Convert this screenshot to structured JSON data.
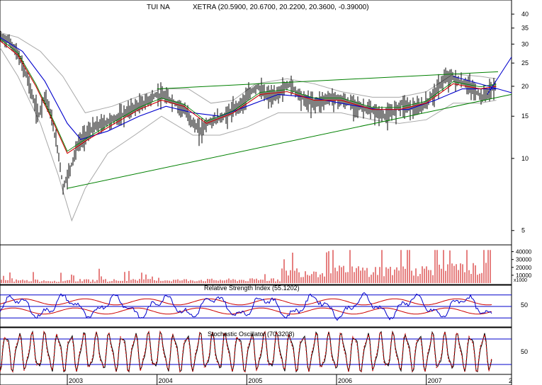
{
  "chart_data": {
    "type": "line",
    "title": {
      "symbol": "TUI NA",
      "quote": "XETRA (20.5900, 20.6700, 20.2200, 20.3600, -0.39000)"
    },
    "price_axis": {
      "scale": "log",
      "ylim": [
        4.6,
        44
      ],
      "ticks": [
        40,
        35,
        30,
        25,
        20,
        15,
        10,
        5
      ]
    },
    "x_axis": {
      "xlim": [
        2002.25,
        2007.95
      ],
      "ticks": [
        2003,
        2004,
        2005,
        2006,
        2007
      ],
      "tick_labels": [
        "2003",
        "2004",
        "2005",
        "2006",
        "2007"
      ],
      "edge_label": "2"
    },
    "price_series": [
      {
        "x": 2002.25,
        "y": 32.0
      },
      {
        "x": 2002.35,
        "y": 31.0
      },
      {
        "x": 2002.45,
        "y": 27.0
      },
      {
        "x": 2002.55,
        "y": 22.0
      },
      {
        "x": 2002.62,
        "y": 17.5
      },
      {
        "x": 2002.68,
        "y": 15.0
      },
      {
        "x": 2002.75,
        "y": 18.5
      },
      {
        "x": 2002.8,
        "y": 16.0
      },
      {
        "x": 2002.86,
        "y": 12.5
      },
      {
        "x": 2002.91,
        "y": 10.0
      },
      {
        "x": 2002.95,
        "y": 7.5
      },
      {
        "x": 2002.99,
        "y": 8.2
      },
      {
        "x": 2003.05,
        "y": 9.5
      },
      {
        "x": 2003.12,
        "y": 11.5
      },
      {
        "x": 2003.2,
        "y": 12.5
      },
      {
        "x": 2003.3,
        "y": 13.5
      },
      {
        "x": 2003.4,
        "y": 14.0
      },
      {
        "x": 2003.5,
        "y": 14.5
      },
      {
        "x": 2003.6,
        "y": 15.0
      },
      {
        "x": 2003.7,
        "y": 16.0
      },
      {
        "x": 2003.85,
        "y": 17.0
      },
      {
        "x": 2003.95,
        "y": 18.0
      },
      {
        "x": 2004.0,
        "y": 18.5
      },
      {
        "x": 2004.1,
        "y": 18.0
      },
      {
        "x": 2004.2,
        "y": 17.0
      },
      {
        "x": 2004.3,
        "y": 16.0
      },
      {
        "x": 2004.4,
        "y": 14.0
      },
      {
        "x": 2004.48,
        "y": 13.0
      },
      {
        "x": 2004.55,
        "y": 14.0
      },
      {
        "x": 2004.65,
        "y": 14.5
      },
      {
        "x": 2004.75,
        "y": 15.0
      },
      {
        "x": 2004.85,
        "y": 16.0
      },
      {
        "x": 2004.95,
        "y": 17.0
      },
      {
        "x": 2005.05,
        "y": 19.0
      },
      {
        "x": 2005.12,
        "y": 20.0
      },
      {
        "x": 2005.2,
        "y": 18.5
      },
      {
        "x": 2005.3,
        "y": 18.0
      },
      {
        "x": 2005.4,
        "y": 19.5
      },
      {
        "x": 2005.48,
        "y": 20.5
      },
      {
        "x": 2005.55,
        "y": 19.0
      },
      {
        "x": 2005.65,
        "y": 17.5
      },
      {
        "x": 2005.75,
        "y": 17.0
      },
      {
        "x": 2005.85,
        "y": 17.5
      },
      {
        "x": 2005.95,
        "y": 18.0
      },
      {
        "x": 2006.05,
        "y": 17.5
      },
      {
        "x": 2006.15,
        "y": 17.0
      },
      {
        "x": 2006.25,
        "y": 16.5
      },
      {
        "x": 2006.35,
        "y": 16.0
      },
      {
        "x": 2006.45,
        "y": 15.5
      },
      {
        "x": 2006.55,
        "y": 15.0
      },
      {
        "x": 2006.62,
        "y": 15.5
      },
      {
        "x": 2006.72,
        "y": 17.0
      },
      {
        "x": 2006.8,
        "y": 16.5
      },
      {
        "x": 2006.9,
        "y": 16.0
      },
      {
        "x": 2007.0,
        "y": 17.0
      },
      {
        "x": 2007.1,
        "y": 19.0
      },
      {
        "x": 2007.2,
        "y": 21.5
      },
      {
        "x": 2007.28,
        "y": 22.0
      },
      {
        "x": 2007.35,
        "y": 21.0
      },
      {
        "x": 2007.45,
        "y": 20.5
      },
      {
        "x": 2007.55,
        "y": 19.0
      },
      {
        "x": 2007.62,
        "y": 18.0
      },
      {
        "x": 2007.7,
        "y": 19.0
      },
      {
        "x": 2007.78,
        "y": 20.4
      }
    ],
    "ma_short": [
      {
        "x": 2002.25,
        "y": 31.0
      },
      {
        "x": 2002.45,
        "y": 27.0
      },
      {
        "x": 2002.65,
        "y": 20.0
      },
      {
        "x": 2002.85,
        "y": 14.0
      },
      {
        "x": 2003.0,
        "y": 10.5
      },
      {
        "x": 2003.2,
        "y": 11.8
      },
      {
        "x": 2003.5,
        "y": 13.8
      },
      {
        "x": 2003.8,
        "y": 16.0
      },
      {
        "x": 2004.05,
        "y": 17.5
      },
      {
        "x": 2004.3,
        "y": 16.5
      },
      {
        "x": 2004.55,
        "y": 14.0
      },
      {
        "x": 2004.85,
        "y": 15.5
      },
      {
        "x": 2005.15,
        "y": 18.5
      },
      {
        "x": 2005.45,
        "y": 19.0
      },
      {
        "x": 2005.75,
        "y": 17.5
      },
      {
        "x": 2006.05,
        "y": 17.5
      },
      {
        "x": 2006.4,
        "y": 16.0
      },
      {
        "x": 2006.7,
        "y": 16.0
      },
      {
        "x": 2007.0,
        "y": 17.0
      },
      {
        "x": 2007.3,
        "y": 20.5
      },
      {
        "x": 2007.6,
        "y": 19.5
      },
      {
        "x": 2007.78,
        "y": 20.0
      }
    ],
    "ma_long": [
      {
        "x": 2002.25,
        "y": 32.0
      },
      {
        "x": 2002.5,
        "y": 28.0
      },
      {
        "x": 2002.75,
        "y": 21.0
      },
      {
        "x": 2003.0,
        "y": 14.0
      },
      {
        "x": 2003.15,
        "y": 12.0
      },
      {
        "x": 2003.45,
        "y": 13.0
      },
      {
        "x": 2003.8,
        "y": 15.0
      },
      {
        "x": 2004.1,
        "y": 16.5
      },
      {
        "x": 2004.4,
        "y": 15.5
      },
      {
        "x": 2004.7,
        "y": 15.0
      },
      {
        "x": 2005.0,
        "y": 16.5
      },
      {
        "x": 2005.35,
        "y": 18.5
      },
      {
        "x": 2005.7,
        "y": 18.0
      },
      {
        "x": 2006.05,
        "y": 17.0
      },
      {
        "x": 2006.45,
        "y": 16.0
      },
      {
        "x": 2006.8,
        "y": 16.0
      },
      {
        "x": 2007.1,
        "y": 17.5
      },
      {
        "x": 2007.4,
        "y": 19.5
      },
      {
        "x": 2007.78,
        "y": 19.5
      }
    ],
    "bollinger_upper": [
      {
        "x": 2002.25,
        "y": 33.5
      },
      {
        "x": 2002.45,
        "y": 32.0
      },
      {
        "x": 2002.7,
        "y": 28.0
      },
      {
        "x": 2002.95,
        "y": 22.0
      },
      {
        "x": 2003.2,
        "y": 15.5
      },
      {
        "x": 2003.5,
        "y": 16.5
      },
      {
        "x": 2003.85,
        "y": 18.5
      },
      {
        "x": 2004.05,
        "y": 19.5
      },
      {
        "x": 2004.35,
        "y": 19.5
      },
      {
        "x": 2004.6,
        "y": 17.0
      },
      {
        "x": 2004.85,
        "y": 17.5
      },
      {
        "x": 2005.1,
        "y": 20.5
      },
      {
        "x": 2005.45,
        "y": 21.5
      },
      {
        "x": 2005.75,
        "y": 20.5
      },
      {
        "x": 2006.05,
        "y": 19.0
      },
      {
        "x": 2006.4,
        "y": 18.0
      },
      {
        "x": 2006.7,
        "y": 18.0
      },
      {
        "x": 2007.0,
        "y": 19.0
      },
      {
        "x": 2007.3,
        "y": 22.5
      },
      {
        "x": 2007.6,
        "y": 22.0
      },
      {
        "x": 2007.78,
        "y": 21.5
      }
    ],
    "bollinger_lower": [
      {
        "x": 2002.25,
        "y": 29.0
      },
      {
        "x": 2002.45,
        "y": 22.0
      },
      {
        "x": 2002.7,
        "y": 14.0
      },
      {
        "x": 2002.9,
        "y": 8.5
      },
      {
        "x": 2003.05,
        "y": 5.5
      },
      {
        "x": 2003.2,
        "y": 7.5
      },
      {
        "x": 2003.45,
        "y": 10.5
      },
      {
        "x": 2003.75,
        "y": 12.5
      },
      {
        "x": 2004.05,
        "y": 15.0
      },
      {
        "x": 2004.4,
        "y": 12.5
      },
      {
        "x": 2004.7,
        "y": 12.5
      },
      {
        "x": 2005.0,
        "y": 13.5
      },
      {
        "x": 2005.35,
        "y": 15.5
      },
      {
        "x": 2005.7,
        "y": 15.5
      },
      {
        "x": 2006.05,
        "y": 15.5
      },
      {
        "x": 2006.4,
        "y": 14.5
      },
      {
        "x": 2006.7,
        "y": 14.0
      },
      {
        "x": 2007.0,
        "y": 14.5
      },
      {
        "x": 2007.3,
        "y": 17.0
      },
      {
        "x": 2007.6,
        "y": 17.0
      },
      {
        "x": 2007.78,
        "y": 17.5
      }
    ],
    "trendlines": [
      {
        "color": "#008000",
        "points": [
          {
            "x": 2004.0,
            "y": 19.5
          },
          {
            "x": 2007.8,
            "y": 23.0
          }
        ]
      },
      {
        "color": "#008000",
        "points": [
          {
            "x": 2003.0,
            "y": 7.5
          },
          {
            "x": 2007.95,
            "y": 18.5
          }
        ]
      },
      {
        "color": "#0000cc",
        "points": [
          {
            "x": 2007.3,
            "y": 22.0
          },
          {
            "x": 2007.95,
            "y": 18.8
          }
        ]
      },
      {
        "color": "#0000cc",
        "points": [
          {
            "x": 2007.68,
            "y": 18.5
          },
          {
            "x": 2007.95,
            "y": 26.5
          }
        ]
      }
    ],
    "volume": {
      "ticks": [
        40000,
        30000,
        20000,
        10000
      ],
      "tick_labels": [
        "40000",
        "30000",
        "20000",
        "10000"
      ],
      "multiplier_label": "x1000",
      "ylim": [
        0,
        45000
      ],
      "color": "#cc0000"
    },
    "rsi": {
      "label": "Relative Strength Index (55.1202)",
      "tick_label": "50",
      "ylim": [
        0,
        100
      ],
      "levels": [
        80,
        50,
        20
      ],
      "colors": {
        "rsi": "#0000cc",
        "bands": "#cc0000"
      }
    },
    "stochastic": {
      "label": "Stochastic Oscillator (70.3208)",
      "tick_label": "50",
      "ylim": [
        0,
        100
      ],
      "levels": [
        80,
        20
      ],
      "colors": {
        "k": "#cc0000",
        "d": "#000000"
      }
    }
  }
}
